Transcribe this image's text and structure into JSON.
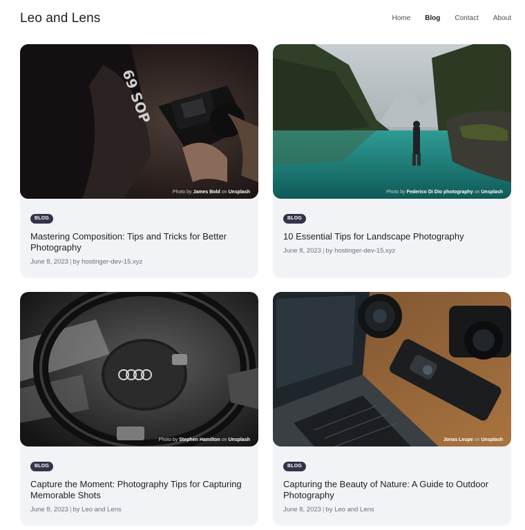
{
  "site": {
    "title": "Leo and Lens",
    "nav": [
      {
        "label": "Home"
      },
      {
        "label": "Blog"
      },
      {
        "label": "Contact"
      },
      {
        "label": "About"
      }
    ]
  },
  "posts": [
    {
      "category": "BLOG",
      "title": "Mastering Composition: Tips and Tricks for Better Photography",
      "date": "June 8, 2023",
      "by": "by hostinger-dev-15.xyz",
      "credit_prefix": "Photo by",
      "credit_author": "James Bold",
      "credit_on": "on",
      "credit_site": "Unsplash"
    },
    {
      "category": "BLOG",
      "title": "10 Essential Tips for Landscape Photography",
      "date": "June 8, 2023",
      "by": "by hostinger-dev-15.xyz",
      "credit_prefix": "Photo by",
      "credit_author": "Federico Di Dio photography",
      "credit_on": "on",
      "credit_site": "Unsplash"
    },
    {
      "category": "BLOG",
      "title": "Capture the Moment: Photography Tips for Capturing Memorable Shots",
      "date": "June 8, 2023",
      "by": "by Leo and Lens",
      "credit_prefix": "Photo by",
      "credit_author": "Stephen Hamilton",
      "credit_on": "on",
      "credit_site": "Unsplash"
    },
    {
      "category": "BLOG",
      "title": "Capturing the Beauty of Nature: A Guide to Outdoor Photography",
      "date": "June 8, 2023",
      "by": "by Leo and Lens",
      "credit_prefix": "",
      "credit_author": "Jonas Leupe",
      "credit_on": "on",
      "credit_site": "Unsplash"
    }
  ],
  "colors": {
    "card_bg": "#f2f3f6",
    "badge_bg": "#33344a",
    "text": "#1d1e20",
    "meta": "#6c6f7a"
  }
}
